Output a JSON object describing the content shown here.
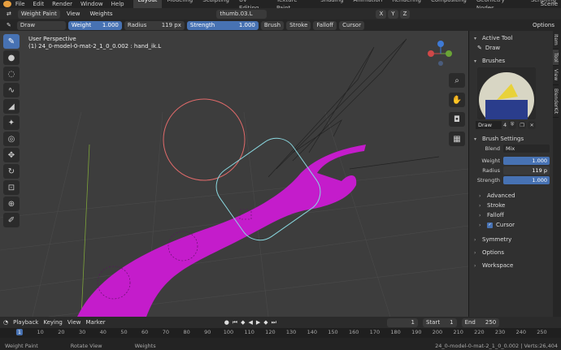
{
  "menu": {
    "items": [
      "File",
      "Edit",
      "Render",
      "Window",
      "Help"
    ]
  },
  "workspaces": {
    "tabs": [
      "Layout",
      "Modeling",
      "Sculpting",
      "UV Editing",
      "Texture Paint",
      "Shading",
      "Animation",
      "Rendering",
      "Compositing",
      "Geometry Nodes",
      "Scripting"
    ],
    "active": "Layout"
  },
  "scene": {
    "label": "Scene"
  },
  "header": {
    "mode": "Weight Paint",
    "view": "View",
    "weights": "Weights",
    "object": "thumb.03.L",
    "options": "Options",
    "axes": [
      "X",
      "Y",
      "Z"
    ]
  },
  "toolsettings": {
    "brush": "Draw",
    "weight_label": "Weight",
    "weight_value": "1.000",
    "radius_label": "Radius",
    "radius_value": "119 px",
    "strength_label": "Strength",
    "strength_value": "1.000",
    "menus": [
      "Brush",
      "Stroke",
      "Falloff",
      "Cursor"
    ]
  },
  "viewport": {
    "perspective": "User Perspective",
    "object_info": "(1) 24_0-model-0-mat-2_1_0_0.002 : hand_ik.L"
  },
  "sidebar": {
    "active_tool_title": "Active Tool",
    "active_tool_name": "Draw",
    "brushes_title": "Brushes",
    "brush_name": "Draw",
    "brush_users": "4",
    "brush_settings_title": "Brush Settings",
    "blend_label": "Blend",
    "blend_value": "Mix",
    "weight_label": "Weight",
    "weight_value": "1.000",
    "radius_label": "Radius",
    "radius_value": "119 p",
    "strength_label": "Strength",
    "strength_value": "1.000",
    "subpanels": [
      "Advanced",
      "Stroke",
      "Falloff"
    ],
    "cursor_label": "Cursor",
    "sections": [
      "Symmetry",
      "Options",
      "Workspace"
    ],
    "tabs": [
      "Item",
      "Tool",
      "View",
      "BlenderKit"
    ]
  },
  "timeline": {
    "menus": [
      "Playback",
      "Keying",
      "View",
      "Marker"
    ],
    "current_frame": "1",
    "start_label": "Start",
    "start_value": "1",
    "end_label": "End",
    "end_value": "250",
    "ticks": [
      "1",
      "10",
      "20",
      "30",
      "40",
      "50",
      "60",
      "70",
      "80",
      "90",
      "100",
      "110",
      "120",
      "130",
      "140",
      "150",
      "160",
      "170",
      "180",
      "190",
      "200",
      "210",
      "220",
      "230",
      "240",
      "250"
    ]
  },
  "status": {
    "items": [
      "Weight Paint",
      "Rotate View",
      "Weights"
    ],
    "right": "24_0-model-0-mat-2_1_0_0.002 | Verts:26,404"
  }
}
